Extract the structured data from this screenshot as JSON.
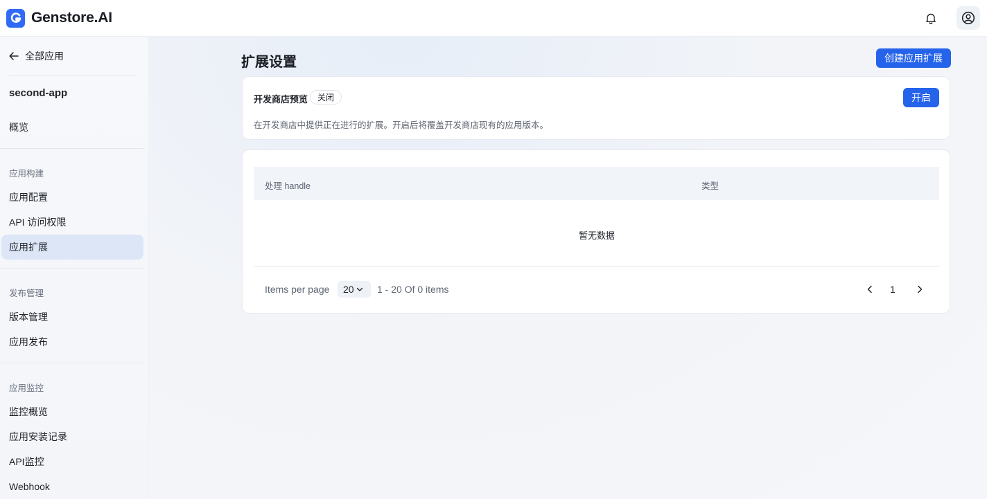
{
  "brand": {
    "name": "Genstore.AI"
  },
  "sidebar": {
    "back_label": "全部应用",
    "app_name": "second-app",
    "overview": "概览",
    "sections": [
      {
        "label": "应用构建",
        "items": [
          "应用配置",
          "API 访问权限",
          "应用扩展"
        ]
      },
      {
        "label": "发布管理",
        "items": [
          "版本管理",
          "应用发布"
        ]
      },
      {
        "label": "应用监控",
        "items": [
          "监控概览",
          "应用安装记录",
          "API监控",
          "Webhook"
        ]
      }
    ],
    "active_item": "应用扩展"
  },
  "main": {
    "title": "扩展设置",
    "create_button": "创建应用扩展",
    "preview": {
      "title": "开发商店预览",
      "status": "关闭",
      "enable_button": "开启",
      "description": "在开发商店中提供正在进行的扩展。开启后将覆盖开发商店现有的应用版本。"
    },
    "table": {
      "columns": [
        "处理 handle",
        "类型"
      ],
      "empty_text": "暂无数据"
    },
    "pagination": {
      "items_per_page_label": "Items per page",
      "per_page_value": "20",
      "range_text": "1 - 20 Of 0 items",
      "current_page": "1"
    }
  },
  "icons": {
    "back": "arrow-left-icon",
    "bell": "bell-icon",
    "user": "user-circle-icon",
    "chevron": "chevron-down-icon"
  },
  "colors": {
    "accent": "#2563eb",
    "active_nav": "#dde6f6"
  }
}
